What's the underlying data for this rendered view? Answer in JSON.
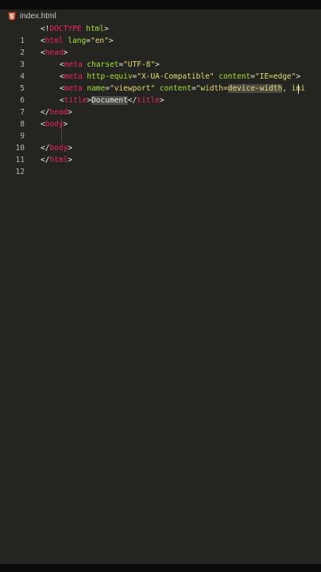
{
  "tab": {
    "label": "index.html",
    "icon": "html5-icon"
  },
  "colors": {
    "background": "#242521",
    "tag": "#f0245f",
    "attribute": "#a6e22e",
    "string": "#e6db74",
    "text": "#e8e8e2",
    "selection": "#4a4b44"
  },
  "editor": {
    "line_numbers": [
      "1",
      "2",
      "3",
      "4",
      "5",
      "6",
      "7",
      "8",
      "9",
      "10",
      "11",
      "12"
    ],
    "line1": {
      "open": "<!",
      "tag": "DOCTYPE",
      "rest": " html",
      "close": ">"
    },
    "line2": {
      "open": "<",
      "tag": "html",
      "attr": " lang",
      "eq": "=",
      "val": "\"en\"",
      "close": ">"
    },
    "line3": {
      "open": "<",
      "tag": "head",
      "close": ">"
    },
    "line4": {
      "open": "<",
      "tag": "meta",
      "attr": " charset",
      "eq": "=",
      "val": "\"UTF-8\"",
      "close": ">"
    },
    "line5": {
      "open": "<",
      "tag": "meta",
      "attr1": " http-equiv",
      "eq1": "=",
      "val1": "\"X-UA-Compatible\"",
      "attr2": " content",
      "eq2": "=",
      "val2": "\"IE=edge\"",
      "close": ">"
    },
    "line6": {
      "open": "<",
      "tag": "meta",
      "attr1": " name",
      "eq1": "=",
      "val1": "\"viewport\"",
      "attr2": " content",
      "eq2": "=",
      "val_pre": "\"width=",
      "val_sel": "device-width",
      "val_post": ", ini"
    },
    "line7": {
      "open": "<",
      "tag": "title",
      "close": ">",
      "text": "Document",
      "end_open": "</",
      "end_tag": "title",
      "end_close": ">"
    },
    "line8": {
      "open": "</",
      "tag": "head",
      "close": ">"
    },
    "line9": {
      "open": "<",
      "tag": "body",
      "close": ">"
    },
    "line11": {
      "open": "</",
      "tag": "body",
      "close": ">"
    },
    "line12": {
      "open": "</",
      "tag": "html",
      "close": ">"
    }
  }
}
